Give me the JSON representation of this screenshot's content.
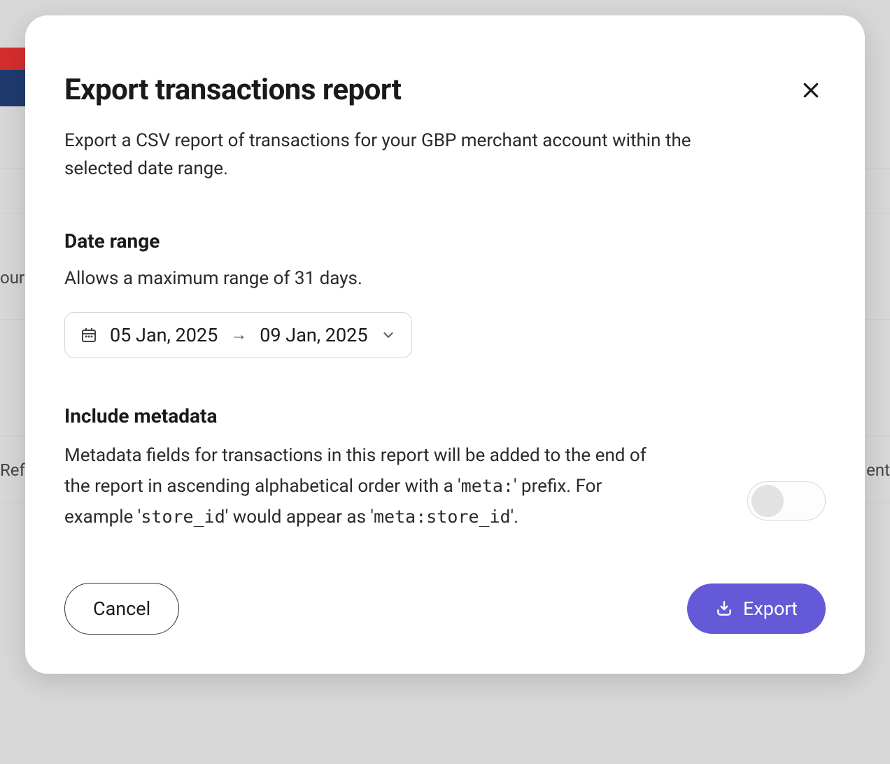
{
  "modal": {
    "title": "Export transactions report",
    "subtitle": "Export a CSV report of transactions for your GBP merchant account within the selected date range.",
    "date_range": {
      "heading": "Date range",
      "help": "Allows a maximum range of 31 days.",
      "start": "05 Jan, 2025",
      "end": "09 Jan, 2025"
    },
    "metadata": {
      "heading": "Include metadata",
      "desc_part1": "Metadata fields for transactions in this report will be added to the end of the report in ascending alphabetical order with a '",
      "code1": "meta:",
      "desc_part2": "' prefix. For example '",
      "code2": "store_id",
      "desc_part3": "' would appear as '",
      "code3": "meta:store_id",
      "desc_part4": "'.",
      "toggle_on": false
    },
    "buttons": {
      "cancel": "Cancel",
      "export": "Export"
    }
  },
  "background": {
    "left_text_1": "our",
    "left_text_2": "Ref",
    "right_text_1": "ent"
  }
}
